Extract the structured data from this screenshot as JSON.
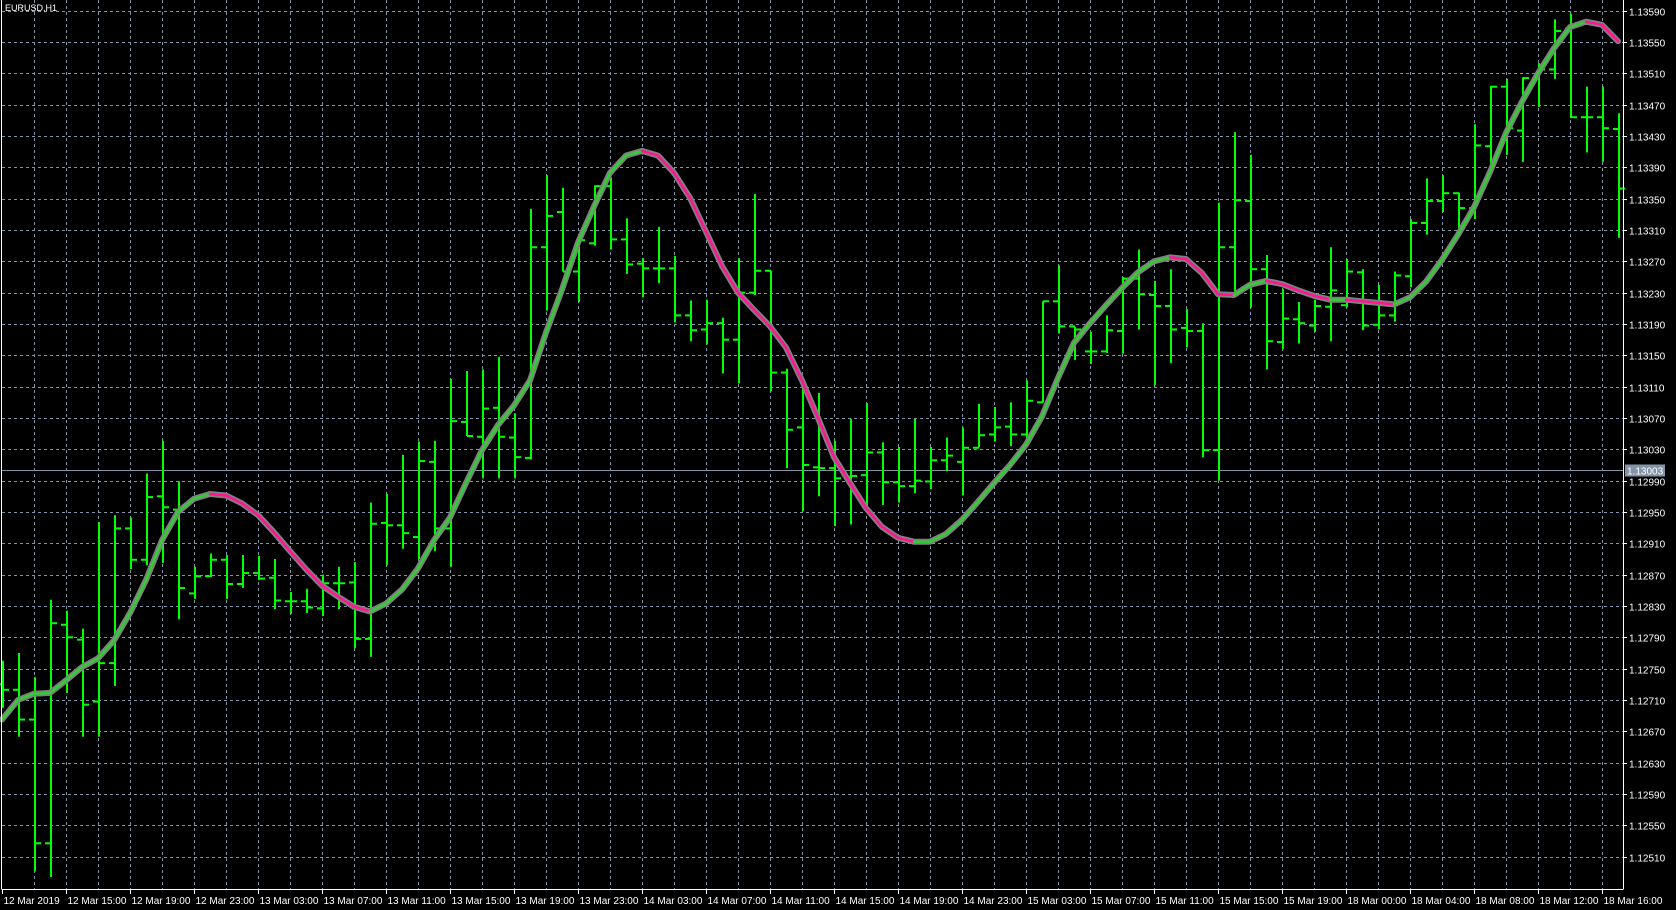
{
  "chart_data": {
    "type": "ohlc-bar",
    "title": "EURUSD,H1",
    "symbol": "EURUSD",
    "timeframe": "H1",
    "current_price": "1.13003",
    "ylim": [
      1.1249,
      1.136
    ],
    "y_ticks": [
      "1.13590",
      "1.13550",
      "1.13510",
      "1.13470",
      "1.13430",
      "1.13390",
      "1.13350",
      "1.13310",
      "1.13270",
      "1.13230",
      "1.13190",
      "1.13150",
      "1.13110",
      "1.13070",
      "1.13030",
      "1.12990",
      "1.12950",
      "1.12910",
      "1.12870",
      "1.12830",
      "1.12790",
      "1.12750",
      "1.12710",
      "1.12670",
      "1.12630",
      "1.12590",
      "1.12550",
      "1.12510"
    ],
    "x_labels": [
      "12 Mar 2019",
      "12 Mar 15:00",
      "12 Mar 19:00",
      "12 Mar 23:00",
      "13 Mar 03:00",
      "13 Mar 07:00",
      "13 Mar 11:00",
      "13 Mar 15:00",
      "13 Mar 19:00",
      "13 Mar 23:00",
      "14 Mar 03:00",
      "14 Mar 07:00",
      "14 Mar 11:00",
      "14 Mar 15:00",
      "14 Mar 19:00",
      "14 Mar 23:00",
      "15 Mar 03:00",
      "15 Mar 07:00",
      "15 Mar 11:00",
      "15 Mar 15:00",
      "15 Mar 19:00",
      "18 Mar 00:00",
      "18 Mar 04:00",
      "18 Mar 08:00",
      "18 Mar 12:00",
      "18 Mar 16:00"
    ],
    "x_label_every_bars": 4,
    "ohlc_columns": [
      "open",
      "high",
      "low",
      "close"
    ],
    "bars": [
      [
        1.1273,
        1.1276,
        1.127,
        1.12723
      ],
      [
        1.12723,
        1.1277,
        1.12663,
        1.12685
      ],
      [
        1.12685,
        1.12739,
        1.12491,
        1.12527
      ],
      [
        1.12527,
        1.12838,
        1.12484,
        1.12808
      ],
      [
        1.12806,
        1.12824,
        1.12719,
        1.1279
      ],
      [
        1.12787,
        1.12801,
        1.12663,
        1.12704
      ],
      [
        1.12708,
        1.12937,
        1.12663,
        1.12757
      ],
      [
        1.12757,
        1.12946,
        1.12728,
        1.12929
      ],
      [
        1.12929,
        1.12943,
        1.12877,
        1.12889
      ],
      [
        1.12889,
        1.12999,
        1.12882,
        1.12969
      ],
      [
        1.1297,
        1.13041,
        1.12885,
        1.12956
      ],
      [
        1.12953,
        1.12989,
        1.12813,
        1.12853
      ],
      [
        1.12846,
        1.1288,
        1.12839,
        1.12868
      ],
      [
        1.12868,
        1.12897,
        1.12867,
        1.12889
      ],
      [
        1.12889,
        1.12895,
        1.12839,
        1.12858
      ],
      [
        1.12858,
        1.12895,
        1.12853,
        1.12872
      ],
      [
        1.12872,
        1.12894,
        1.12863,
        1.12865
      ],
      [
        1.12866,
        1.1289,
        1.12826,
        1.12837
      ],
      [
        1.12836,
        1.12848,
        1.1282,
        1.12836
      ],
      [
        1.12836,
        1.12852,
        1.12821,
        1.12828
      ],
      [
        1.12827,
        1.1287,
        1.12817,
        1.12859
      ],
      [
        1.12859,
        1.1288,
        1.12826,
        1.12859
      ],
      [
        1.1286,
        1.12886,
        1.12776,
        1.12788
      ],
      [
        1.12788,
        1.12962,
        1.12765,
        1.12935
      ],
      [
        1.12936,
        1.12973,
        1.12882,
        1.12933
      ],
      [
        1.12933,
        1.13023,
        1.12903,
        1.12923
      ],
      [
        1.12918,
        1.1304,
        1.1289,
        1.13015
      ],
      [
        1.13014,
        1.13041,
        1.129,
        1.12929
      ],
      [
        1.12929,
        1.1312,
        1.1288,
        1.13066
      ],
      [
        1.13065,
        1.1313,
        1.13047,
        1.13047
      ],
      [
        1.13046,
        1.13132,
        1.12993,
        1.13082
      ],
      [
        1.13083,
        1.13148,
        1.12993,
        1.13046
      ],
      [
        1.13045,
        1.13076,
        1.12993,
        1.1302
      ],
      [
        1.13019,
        1.13337,
        1.13017,
        1.13288
      ],
      [
        1.13288,
        1.1338,
        1.13207,
        1.13328
      ],
      [
        1.13333,
        1.13364,
        1.13257,
        1.13257
      ],
      [
        1.13257,
        1.13298,
        1.13218,
        1.13297
      ],
      [
        1.13293,
        1.13367,
        1.1329,
        1.13366
      ],
      [
        1.13366,
        1.13377,
        1.13285,
        1.13298
      ],
      [
        1.13298,
        1.13325,
        1.13254,
        1.13266
      ],
      [
        1.13267,
        1.13274,
        1.13224,
        1.13261
      ],
      [
        1.13261,
        1.13314,
        1.13242,
        1.13261
      ],
      [
        1.13261,
        1.13277,
        1.13192,
        1.13201
      ],
      [
        1.13201,
        1.1322,
        1.13168,
        1.13182
      ],
      [
        1.13183,
        1.13221,
        1.13164,
        1.13191
      ],
      [
        1.13191,
        1.13198,
        1.13127,
        1.1317
      ],
      [
        1.1317,
        1.13274,
        1.13114,
        1.1323
      ],
      [
        1.1323,
        1.13356,
        1.13227,
        1.13258
      ],
      [
        1.13258,
        1.13258,
        1.13104,
        1.13128
      ],
      [
        1.13128,
        1.13133,
        1.13006,
        1.13055
      ],
      [
        1.13058,
        1.13109,
        1.12951,
        1.1301
      ],
      [
        1.13007,
        1.13102,
        1.1297,
        1.13006
      ],
      [
        1.13006,
        1.13041,
        1.12932,
        1.12993
      ],
      [
        1.12995,
        1.13069,
        1.12934,
        1.12996
      ],
      [
        1.12997,
        1.13089,
        1.12957,
        1.13026
      ],
      [
        1.13026,
        1.13039,
        1.12959,
        1.12988
      ],
      [
        1.12988,
        1.13033,
        1.12962,
        1.12983
      ],
      [
        1.12983,
        1.13069,
        1.12974,
        1.1299
      ],
      [
        1.12989,
        1.13033,
        1.12979,
        1.13016
      ],
      [
        1.13016,
        1.13045,
        1.13002,
        1.13022
      ],
      [
        1.13014,
        1.13058,
        1.12971,
        1.13032
      ],
      [
        1.13032,
        1.13088,
        1.13033,
        1.13048
      ],
      [
        1.13049,
        1.13084,
        1.1304,
        1.13058
      ],
      [
        1.13059,
        1.1309,
        1.13034,
        1.13049
      ],
      [
        1.13049,
        1.13118,
        1.13036,
        1.13092
      ],
      [
        1.1309,
        1.13219,
        1.1309,
        1.13219
      ],
      [
        1.13219,
        1.13265,
        1.13178,
        1.13187
      ],
      [
        1.13187,
        1.13186,
        1.13144,
        1.13183
      ],
      [
        1.13155,
        1.1318,
        1.13139,
        1.13155
      ],
      [
        1.13155,
        1.13201,
        1.13153,
        1.13182
      ],
      [
        1.13181,
        1.1325,
        1.13152,
        1.13248
      ],
      [
        1.13248,
        1.13285,
        1.13183,
        1.13228
      ],
      [
        1.13227,
        1.13245,
        1.13112,
        1.13213
      ],
      [
        1.13213,
        1.1326,
        1.1314,
        1.13183
      ],
      [
        1.13185,
        1.13209,
        1.1316,
        1.13181
      ],
      [
        1.13181,
        1.13191,
        1.1302,
        1.13029
      ],
      [
        1.13029,
        1.13345,
        1.1299,
        1.13288
      ],
      [
        1.13288,
        1.13435,
        1.13232,
        1.13348
      ],
      [
        1.13347,
        1.13406,
        1.13211,
        1.1326
      ],
      [
        1.1326,
        1.13278,
        1.13132,
        1.13168
      ],
      [
        1.13167,
        1.13235,
        1.13158,
        1.13197
      ],
      [
        1.13196,
        1.13218,
        1.13165,
        1.13191
      ],
      [
        1.13188,
        1.13221,
        1.1318,
        1.13213
      ],
      [
        1.13212,
        1.13288,
        1.13168,
        1.13233
      ],
      [
        1.13214,
        1.13273,
        1.13211,
        1.13257
      ],
      [
        1.13256,
        1.1326,
        1.13182,
        1.13188
      ],
      [
        1.13189,
        1.1324,
        1.13183,
        1.13201
      ],
      [
        1.13201,
        1.13257,
        1.13193,
        1.13252
      ],
      [
        1.13251,
        1.13324,
        1.13237,
        1.13319
      ],
      [
        1.13319,
        1.13376,
        1.13304,
        1.13347
      ],
      [
        1.13347,
        1.1338,
        1.13333,
        1.13357
      ],
      [
        1.13357,
        1.13357,
        1.13312,
        1.13338
      ],
      [
        1.13338,
        1.13445,
        1.13324,
        1.13418
      ],
      [
        1.13417,
        1.13494,
        1.13389,
        1.13493
      ],
      [
        1.13493,
        1.13503,
        1.13406,
        1.1344
      ],
      [
        1.13437,
        1.13505,
        1.13397,
        1.13504
      ],
      [
        1.13505,
        1.13523,
        1.13467,
        1.13515
      ],
      [
        1.13515,
        1.13579,
        1.13503,
        1.13564
      ],
      [
        1.13567,
        1.13586,
        1.13453,
        1.13454
      ],
      [
        1.13454,
        1.13493,
        1.13409,
        1.13454
      ],
      [
        1.13454,
        1.13493,
        1.13397,
        1.1344
      ],
      [
        1.13439,
        1.13459,
        1.133,
        1.13363
      ]
    ],
    "moving_average": [
      1.12685,
      1.1271,
      1.12718,
      1.12719,
      1.12735,
      1.12752,
      1.12763,
      1.12786,
      1.12821,
      1.12863,
      1.12914,
      1.1295,
      1.12967,
      1.12973,
      1.12971,
      1.12961,
      1.12946,
      1.12924,
      1.129,
      1.12877,
      1.12856,
      1.12842,
      1.12829,
      1.12823,
      1.12833,
      1.12851,
      1.12878,
      1.12914,
      1.12943,
      1.12987,
      1.13029,
      1.13061,
      1.13086,
      1.13118,
      1.13179,
      1.13234,
      1.13294,
      1.1334,
      1.13383,
      1.13405,
      1.13411,
      1.13405,
      1.13383,
      1.13351,
      1.13308,
      1.13264,
      1.1323,
      1.13208,
      1.13187,
      1.1316,
      1.13118,
      1.1307,
      1.1302,
      1.12987,
      1.12955,
      1.12931,
      1.12917,
      1.12912,
      1.12912,
      1.12922,
      1.1294,
      1.12963,
      1.12987,
      1.1301,
      1.13036,
      1.13072,
      1.13121,
      1.13166,
      1.13191,
      1.13214,
      1.13236,
      1.13256,
      1.1327,
      1.13275,
      1.13273,
      1.13255,
      1.13228,
      1.13227,
      1.1324,
      1.13245,
      1.13241,
      1.13233,
      1.13226,
      1.13221,
      1.13221,
      1.13219,
      1.13217,
      1.13215,
      1.13224,
      1.13244,
      1.13272,
      1.13304,
      1.13339,
      1.13384,
      1.13434,
      1.13474,
      1.1351,
      1.13542,
      1.13569,
      1.13576,
      1.13572,
      1.13551
    ],
    "colors": {
      "background": "#000000",
      "bars": "#00ff00",
      "grid": "#8494a8",
      "axis": "#ffffff",
      "ma_up": "#32cd32",
      "ma_down": "#ff1493",
      "ma_outline": "#808080",
      "price_line": "#8494a8",
      "price_label_bg": "#8494a8"
    },
    "grid": true
  }
}
